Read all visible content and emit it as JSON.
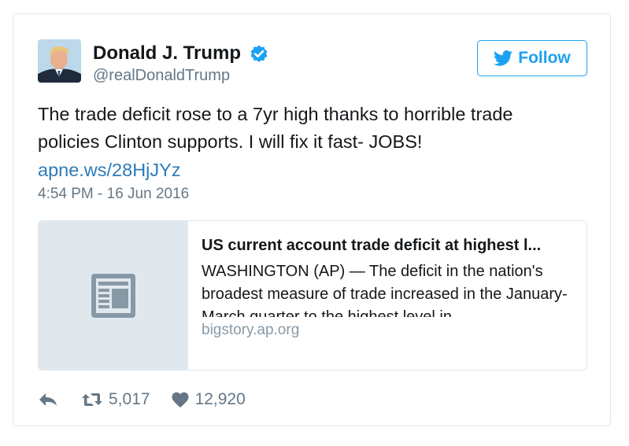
{
  "user": {
    "display_name": "Donald J. Trump",
    "handle": "@realDonaldTrump",
    "verified": true
  },
  "follow_button": {
    "label": "Follow"
  },
  "tweet": {
    "text": "The trade deficit rose to a 7yr high thanks to horrible trade policies Clinton supports. I will fix it fast- JOBS!",
    "link": "apne.ws/28HjJYz",
    "timestamp": "4:54 PM - 16 Jun 2016"
  },
  "link_card": {
    "title": "US current account trade deficit at highest l...",
    "description": "WASHINGTON (AP) — The deficit in the nation's broadest measure of trade increased in the January-March quarter to the highest level in",
    "domain": "bigstory.ap.org",
    "thumbnail_icon": "article-icon"
  },
  "stats": {
    "retweets": "5,017",
    "likes": "12,920"
  },
  "colors": {
    "accent": "#1da1f2",
    "link": "#2b7bb9",
    "muted": "#657786",
    "border": "#e1e8ed"
  }
}
